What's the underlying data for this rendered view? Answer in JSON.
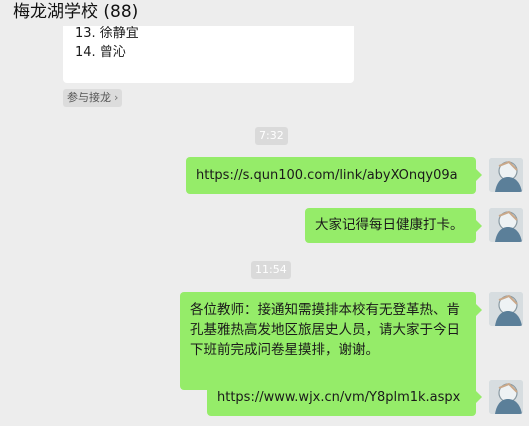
{
  "header": {
    "title": "梅龙湖学校 (88)"
  },
  "jielong": {
    "lines": [
      "13. 徐静宜",
      "14. 曾沁"
    ],
    "join_label": "参与接龙",
    "join_chevron": "›"
  },
  "timestamps": [
    "7:32",
    "11:54"
  ],
  "messages": [
    {
      "text": "https://s.qun100.com/link/abyXOnqy09a"
    },
    {
      "text": "大家记得每日健康打卡。"
    },
    {
      "text": "各位教师：接通知需摸排本校有无登革热、肯孔基雅热高发地区旅居史人员，请大家于今日下班前完成问卷星摸排，谢谢。"
    },
    {
      "text": "https://www.wjx.cn/vm/Y8plm1k.aspx"
    }
  ],
  "colors": {
    "background": "#ededed",
    "bubble_self": "#95ec69",
    "card": "#ffffff"
  },
  "icons": {
    "avatar": "user-avatar-icon",
    "chevron": "chevron-right-icon"
  }
}
